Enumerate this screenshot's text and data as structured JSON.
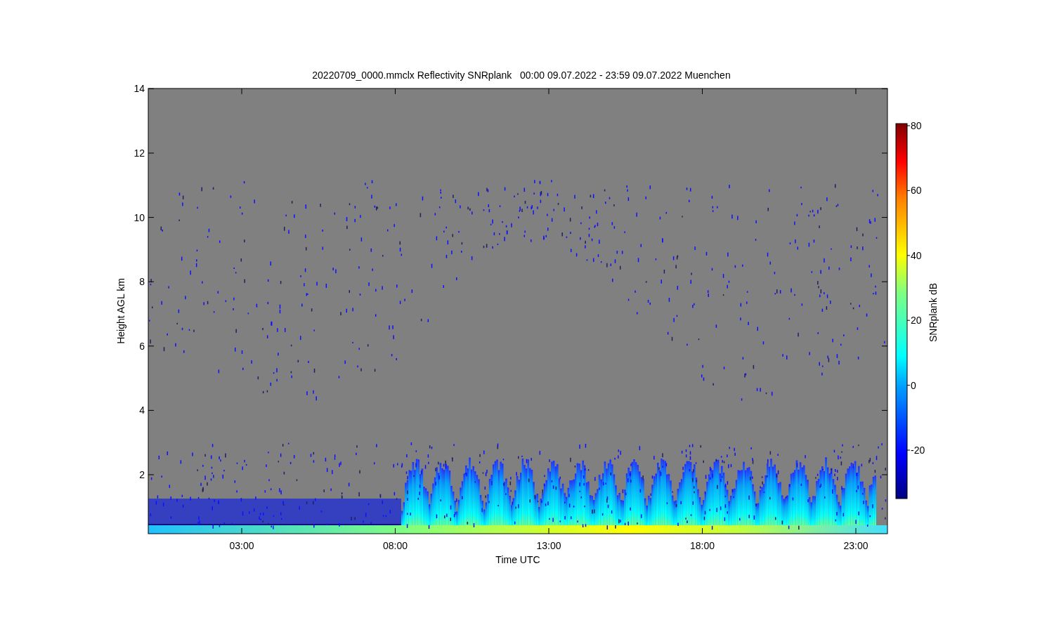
{
  "title": "20220709_0000.mmclx Reflectivity SNRplank   00:00 09.07.2022 - 23:59 09.07.2022 Muenchen",
  "y_axis": {
    "label": "Height AGL km",
    "ticks": [
      "14",
      "12",
      "10",
      "8",
      "6",
      "4",
      "2"
    ]
  },
  "x_axis": {
    "label": "Time UTC",
    "ticks": [
      "03:00",
      "08:00",
      "13:00",
      "18:00",
      "23:00"
    ]
  },
  "colorbar": {
    "label": "SNRplank dB",
    "ticks": [
      "80",
      "60",
      "40",
      "20",
      "0",
      "-20"
    ]
  }
}
